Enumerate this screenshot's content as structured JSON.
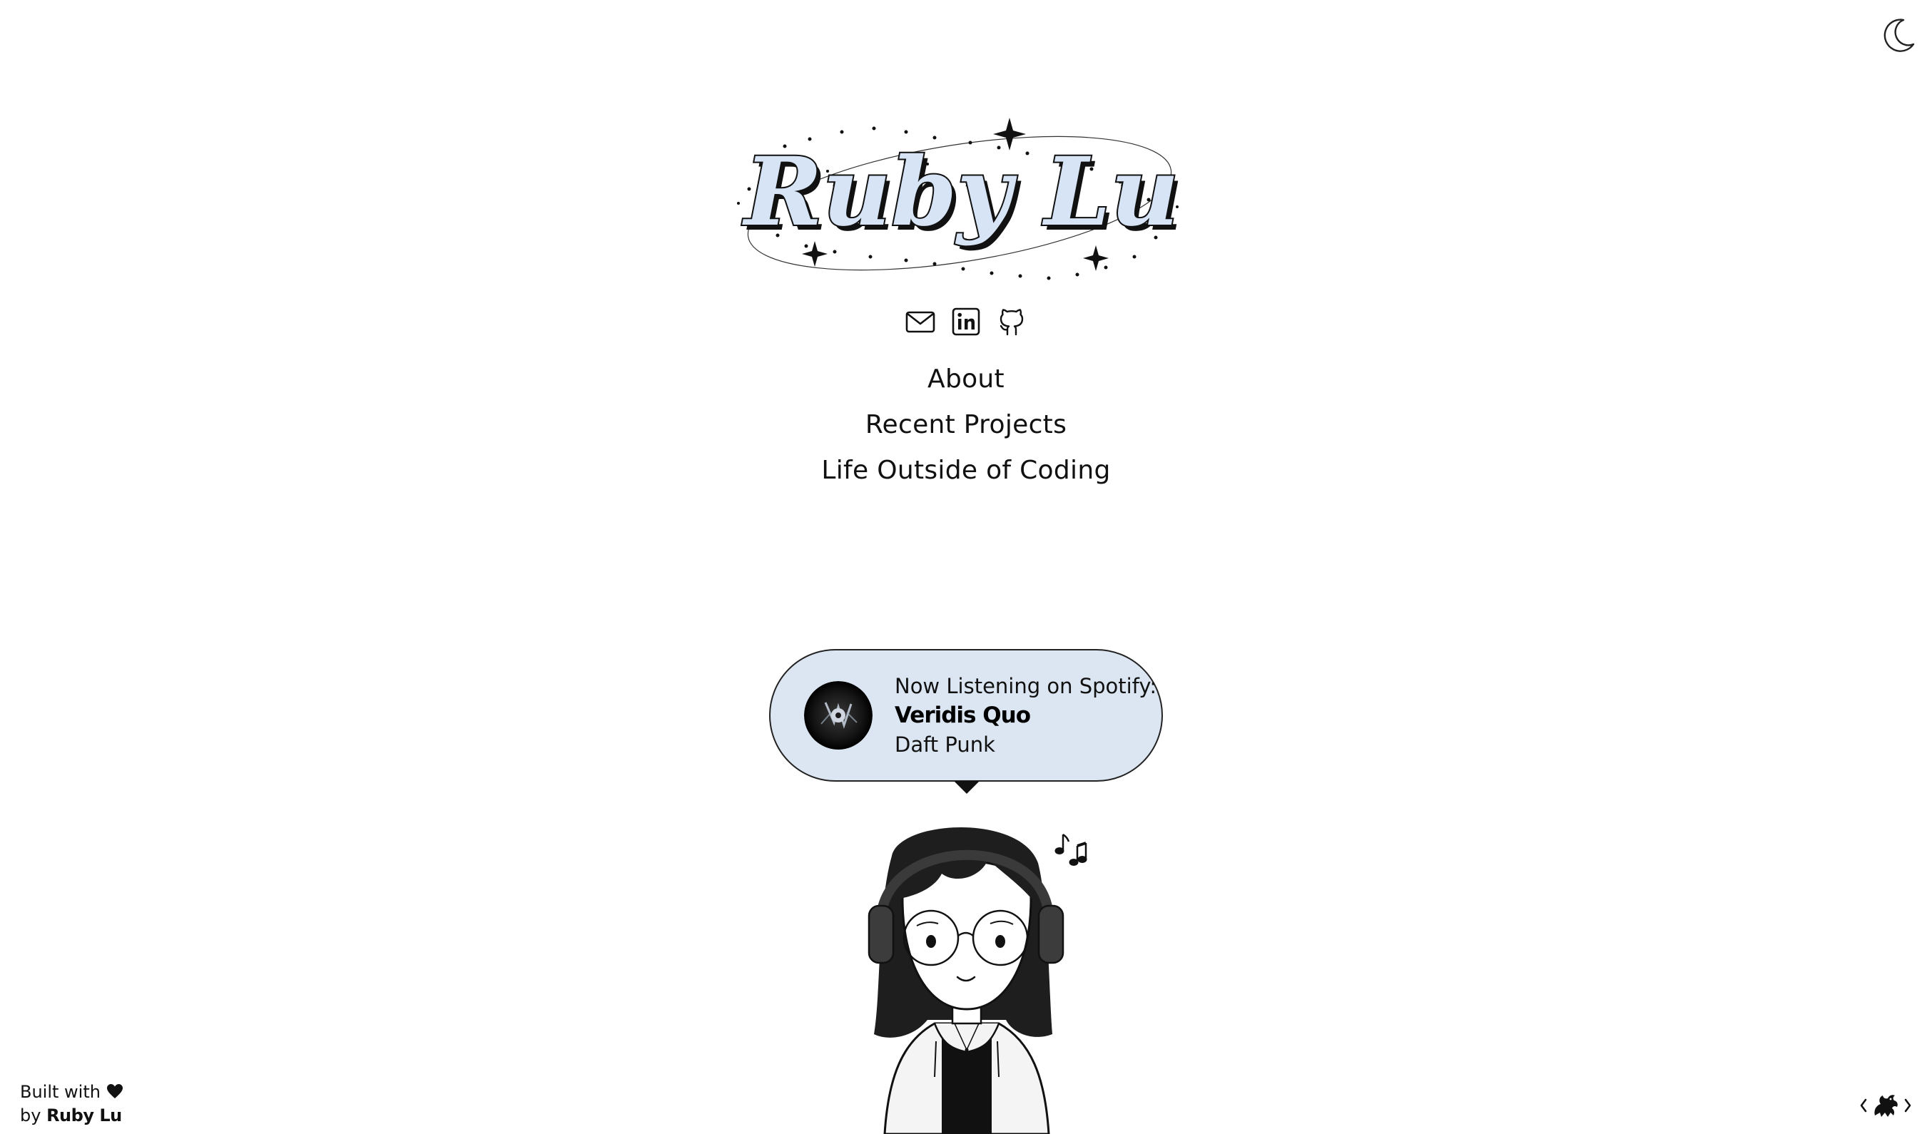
{
  "logo": {
    "text": "Ruby Lu",
    "fill_color": "#d6e4f5"
  },
  "header": {
    "theme_toggle_icon": "moon-icon"
  },
  "socials": [
    {
      "icon": "mail-icon"
    },
    {
      "icon": "linkedin-icon"
    },
    {
      "icon": "github-icon"
    }
  ],
  "nav": {
    "items": [
      {
        "label": "About"
      },
      {
        "label": "Recent Projects"
      },
      {
        "label": "Life Outside of Coding"
      }
    ]
  },
  "now_playing": {
    "label": "Now Listening on Spotify:",
    "track": "Veridis Quo",
    "artist": "Daft Punk",
    "bubble_color": "#dce6f2",
    "album_art_icon": "album-art-disc"
  },
  "character": {
    "icon": "girl-with-headphones-illustration",
    "notes_icon": "music-notes-icon"
  },
  "footer": {
    "built_with": "Built with",
    "heart_icon": "heart-icon",
    "by": "by",
    "author": "Ruby Lu"
  },
  "corner_badge": {
    "icon": "dragon-badge-icon"
  }
}
